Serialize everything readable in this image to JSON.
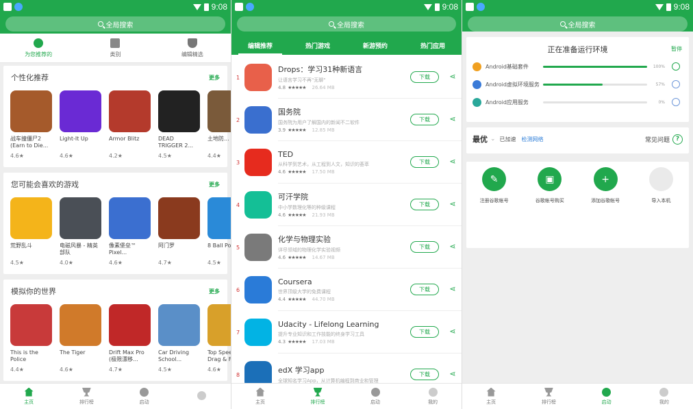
{
  "status": {
    "time": "9:08"
  },
  "screen1": {
    "search_placeholder": "全局搜索",
    "tabs": [
      {
        "label": "为您推荐的",
        "icon": "compass-icon",
        "active": true
      },
      {
        "label": "类别",
        "icon": "shapes-icon",
        "active": false
      },
      {
        "label": "编辑精选",
        "icon": "badge-icon",
        "active": false
      }
    ],
    "sections": [
      {
        "title": "个性化推荐",
        "more": "更多",
        "apps": [
          {
            "name": "战车撞僵尸2 (Earn to Die...",
            "rating": "4.6★",
            "color": "#a55a2b"
          },
          {
            "name": "Light-It Up",
            "rating": "4.6★",
            "color": "#6a2ad4"
          },
          {
            "name": "Armor Blitz",
            "rating": "4.2★",
            "color": "#b43a2c"
          },
          {
            "name": "DEAD TRIGGER 2...",
            "rating": "4.5★",
            "color": "#222222"
          },
          {
            "name": "土地防...",
            "rating": "4.4★",
            "color": "#7a5a3a"
          }
        ]
      },
      {
        "title": "您可能会喜欢的游戏",
        "more": "更多",
        "apps": [
          {
            "name": "荒野乱斗",
            "rating": "4.5★",
            "color": "#f4b41a"
          },
          {
            "name": "电磁风暴 - 精英部队",
            "rating": "4.0★",
            "color": "#4a4f56"
          },
          {
            "name": "像素堡垒™ Pixel...",
            "rating": "4.6★",
            "color": "#3b6fd0"
          },
          {
            "name": "阿门罗",
            "rating": "4.7★",
            "color": "#8a3a1e"
          },
          {
            "name": "8 Ball Po...",
            "rating": "4.5★",
            "color": "#2a8ad8"
          }
        ]
      },
      {
        "title": "模拟你的世界",
        "more": "更多",
        "apps": [
          {
            "name": "This is the Police",
            "rating": "4.4★",
            "color": "#c83a3a"
          },
          {
            "name": "The Tiger",
            "rating": "4.6★",
            "color": "#d07a2a"
          },
          {
            "name": "Drift Max Pro (极限漂移...",
            "rating": "4.7★",
            "color": "#c02828"
          },
          {
            "name": "Car Driving School...",
            "rating": "4.5★",
            "color": "#5a8fc8"
          },
          {
            "name": "Top Spee... Drag & F...",
            "rating": "4.6★",
            "color": "#d8a02a"
          }
        ]
      }
    ],
    "nav": [
      {
        "label": "主页",
        "icon": "home-icon",
        "active": true
      },
      {
        "label": "排行榜",
        "icon": "trophy-icon",
        "active": false
      },
      {
        "label": "启动",
        "icon": "play-icon",
        "active": false
      },
      {
        "label": "",
        "icon": "me-icon",
        "active": false
      }
    ]
  },
  "screen2": {
    "search_placeholder": "全局搜索",
    "tabs": [
      {
        "label": "编辑推荐",
        "active": true
      },
      {
        "label": "热门游戏",
        "active": false
      },
      {
        "label": "新游预约",
        "active": false
      },
      {
        "label": "热门应用",
        "active": false
      }
    ],
    "items": [
      {
        "rank": "1",
        "name": "Drops：学习31种新语言",
        "desc": "让语言学习不再\"无聊\"",
        "rating": "4.8",
        "stars": "★★★★★",
        "size": "26.64 MB",
        "btn": "下载",
        "color": "#e8604a"
      },
      {
        "rank": "2",
        "name": "国务院",
        "desc": "国务院为用户了解国内的新闻不二软件",
        "rating": "3.9",
        "stars": "★★★★★",
        "size": "12.85 MB",
        "btn": "下载",
        "color": "#3a6fcf"
      },
      {
        "rank": "3",
        "name": "TED",
        "desc": "从科学到艺术，从工程到人文，知识的荟萃",
        "rating": "4.6",
        "stars": "★★★★★",
        "size": "17.50 MB",
        "btn": "下载",
        "color": "#e62b1e"
      },
      {
        "rank": "4",
        "name": "可汗学院",
        "desc": "中小学数理化等的种级课程",
        "rating": "4.6",
        "stars": "★★★★★",
        "size": "21.93 MB",
        "btn": "下载",
        "color": "#14bf96"
      },
      {
        "rank": "5",
        "name": "化学与物理实验",
        "desc": "详尽领域的物理化学实验视频",
        "rating": "4.6",
        "stars": "★★★★★",
        "size": "14.67 MB",
        "btn": "下载",
        "color": "#7a7a7a"
      },
      {
        "rank": "6",
        "name": "Coursera",
        "desc": "世界顶级大学的免费课程",
        "rating": "4.4",
        "stars": "★★★★★",
        "size": "44.70 MB",
        "btn": "下载",
        "color": "#2a7bd8"
      },
      {
        "rank": "7",
        "name": "Udacity - Lifelong Learning",
        "desc": "提升专业知识和工作技能的终身学习工具",
        "rating": "4.3",
        "stars": "★★★★★",
        "size": "17.03 MB",
        "btn": "下载",
        "color": "#02b3e4"
      },
      {
        "rank": "8",
        "name": "edX 学习app",
        "desc": "全球知名学习App，从计算机编程到商业和管理",
        "rating": "",
        "stars": "",
        "size": "",
        "btn": "下载",
        "color": "#1b6fb8"
      }
    ],
    "nav": [
      {
        "label": "主页",
        "icon": "home-icon",
        "active": false
      },
      {
        "label": "排行榜",
        "icon": "trophy-icon",
        "active": true
      },
      {
        "label": "启动",
        "icon": "play-icon",
        "active": false
      },
      {
        "label": "我的",
        "icon": "me-icon",
        "active": false
      }
    ]
  },
  "screen3": {
    "search_placeholder": "全局搜索",
    "env_title": "正在准备运行环境",
    "pause": "暂停",
    "env_rows": [
      {
        "label": "Android基础套件",
        "progress": 1.0,
        "pct": "100%",
        "color": "#f0a020"
      },
      {
        "label": "Android虚拟环境服务",
        "progress": 0.57,
        "pct": "57%",
        "color": "#3a7bd8"
      },
      {
        "label": "Android应用服务",
        "progress": 0.0,
        "pct": "0%",
        "color": "#2aa89a"
      }
    ],
    "speed": {
      "mode": "最优",
      "accelerated": "已加速",
      "check": "检测网络",
      "faq": "常见问题"
    },
    "actions": [
      {
        "label": "注册谷歌帐号",
        "icon": "edit-icon",
        "active": true
      },
      {
        "label": "谷歌帐号购买",
        "icon": "cart-icon",
        "active": true
      },
      {
        "label": "添加谷歌帐号",
        "icon": "add-user-icon",
        "active": true
      },
      {
        "label": "导入本机",
        "icon": "import-icon",
        "active": false
      }
    ],
    "nav": [
      {
        "label": "主页",
        "icon": "home-icon",
        "active": false
      },
      {
        "label": "排行榜",
        "icon": "trophy-icon",
        "active": false
      },
      {
        "label": "启动",
        "icon": "play-icon",
        "active": true
      },
      {
        "label": "我的",
        "icon": "me-icon",
        "active": false
      }
    ]
  }
}
